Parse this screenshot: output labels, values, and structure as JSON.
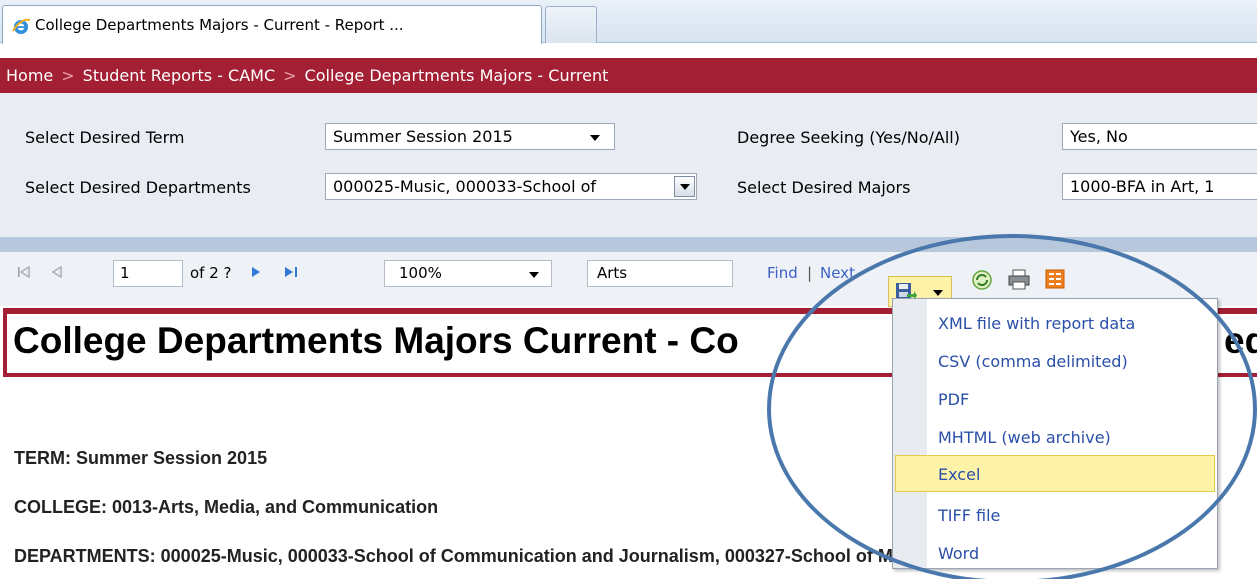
{
  "browser": {
    "tab_title": "College Departments Majors - Current - Report ..."
  },
  "breadcrumb": {
    "items": [
      "Home",
      "Student Reports - CAMC",
      "College Departments Majors - Current"
    ],
    "separator": ">"
  },
  "parameters": {
    "term_label": "Select Desired Term",
    "term_value": "Summer Session 2015",
    "degree_label": "Degree Seeking (Yes/No/All)",
    "degree_value": "Yes, No",
    "departments_label": "Select Desired Departments",
    "departments_value": "000025-Music, 000033-School of",
    "majors_label": "Select Desired Majors",
    "majors_value": "1000-BFA in Art, 1"
  },
  "toolbar": {
    "page_value": "1",
    "page_of": "of 2 ?",
    "zoom_value": "100%",
    "find_value": "Arts",
    "find_label": "Find",
    "divider": "|",
    "next_label": "Next"
  },
  "report": {
    "title": "College Departments Majors Current - Co",
    "title_tail": "ed",
    "term_line": "TERM: Summer Session 2015",
    "college_line": "COLLEGE: 0013-Arts, Media, and Communication",
    "departments_line": "DEPARTMENTS: 000025-Music, 000033-School of Communication and Journalism, 000327-School of Media Arts"
  },
  "export_menu": {
    "items": [
      "XML file with report data",
      "CSV (comma delimited)",
      "PDF",
      "MHTML (web archive)",
      "Excel",
      "TIFF file",
      "Word"
    ],
    "selected": "Excel"
  },
  "colors": {
    "brand_red": "#a31f34",
    "link_blue": "#3c62c6",
    "highlight_yellow": "#fcf2a8",
    "annotation_circle": "#4a78ad"
  }
}
